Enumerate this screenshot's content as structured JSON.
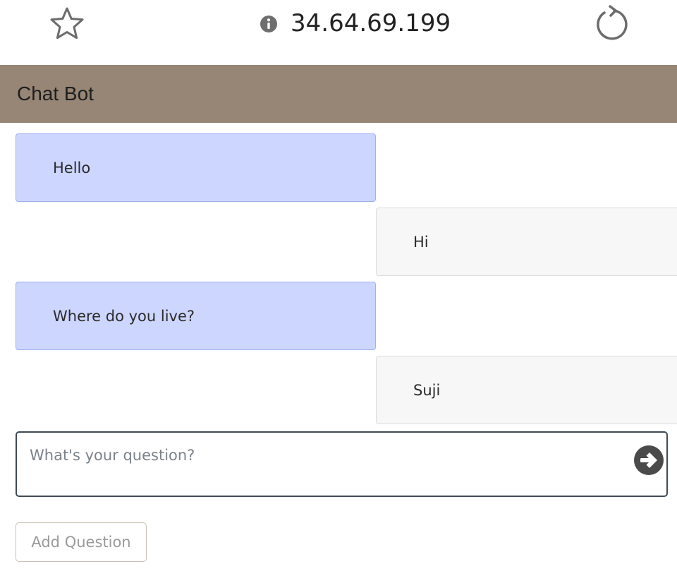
{
  "browser": {
    "url": "34.64.69.199",
    "icons": {
      "bookmark": "star-icon",
      "site_info": "info-icon",
      "reload": "reload-icon"
    }
  },
  "app": {
    "title": "Chat Bot",
    "header_color": "#978675"
  },
  "conversation": [
    {
      "role": "user",
      "text": "Hello"
    },
    {
      "role": "bot",
      "text": "Hi"
    },
    {
      "role": "user",
      "text": "Where do you live?"
    },
    {
      "role": "bot",
      "text": "Suji"
    }
  ],
  "colors": {
    "user_bubble": "#cdd6ff",
    "bot_bubble": "#f7f7f7"
  },
  "question": {
    "placeholder": "What's your question?",
    "value": "",
    "send_icon": "arrow-right-circle-icon"
  },
  "add_question": {
    "label": "Add Question"
  }
}
